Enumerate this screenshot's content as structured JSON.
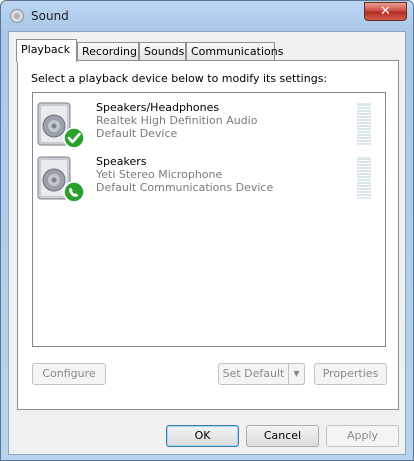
{
  "window": {
    "title": "Sound",
    "close_glyph": "✕"
  },
  "tabs": [
    {
      "label": "Playback",
      "active": true
    },
    {
      "label": "Recording",
      "active": false
    },
    {
      "label": "Sounds",
      "active": false
    },
    {
      "label": "Communications",
      "active": false
    }
  ],
  "instructions": "Select a playback device below to modify its settings:",
  "devices": [
    {
      "name": "Speakers/Headphones",
      "driver": "Realtek High Definition Audio",
      "status": "Default Device",
      "badge_icon": "green-checkmark-icon",
      "device_icon": "speaker-icon"
    },
    {
      "name": "Speakers",
      "driver": "Yeti Stereo Microphone",
      "status": "Default Communications Device",
      "badge_icon": "green-phone-icon",
      "device_icon": "speaker-icon"
    }
  ],
  "buttons": {
    "configure": "Configure",
    "set_default": "Set Default",
    "properties": "Properties",
    "ok": "OK",
    "cancel": "Cancel",
    "apply": "Apply"
  },
  "colors": {
    "window_frame": "#a9c8ea",
    "close_button": "#c8473a",
    "badge_green": "#2aa12f"
  }
}
